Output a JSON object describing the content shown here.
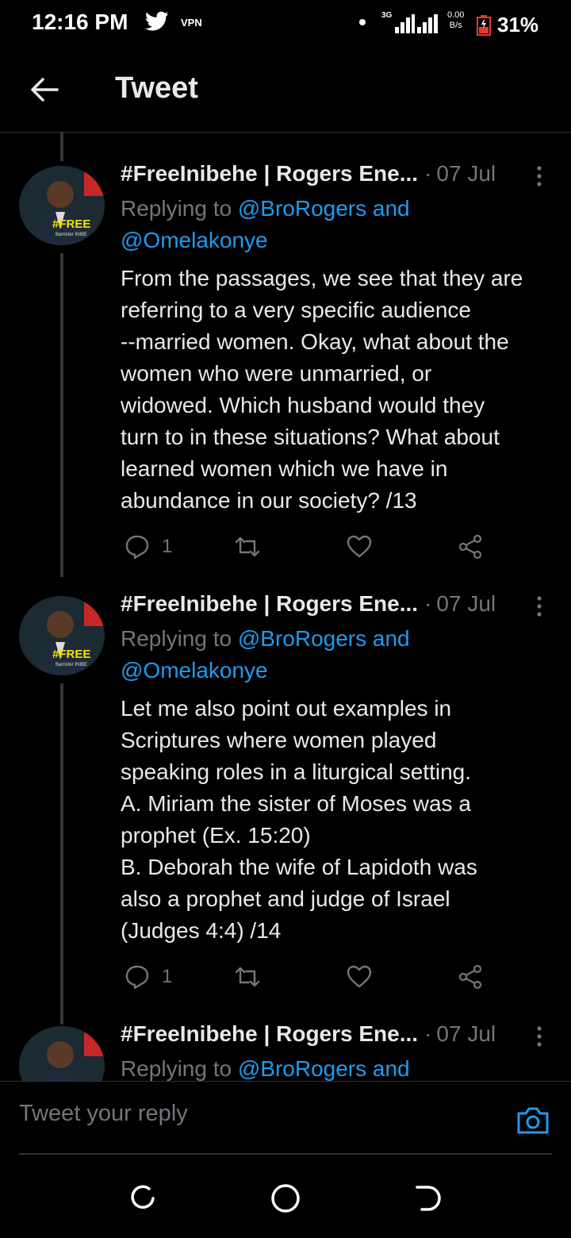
{
  "status_bar": {
    "time": "12:16 PM",
    "vpn": "VPN",
    "network_type": "3G",
    "speed_value": "0.00",
    "speed_unit": "B/s",
    "battery": "31%",
    "icons": [
      "twitter-icon",
      "signal-icon",
      "battery-icon"
    ]
  },
  "header": {
    "title": "Tweet",
    "back_icon": "arrow-left-icon"
  },
  "tweets": [
    {
      "author": "#FreeInibehe | Rogers Ene...",
      "separator": "·",
      "date": "07 Jul",
      "reply_prefix": "Replying to",
      "mention1": "@BroRogers and",
      "mention2": "@Omelakonye",
      "body": "From the passages, we see that they are\nreferring to a very specific audience\n--married women. Okay, what about the\nwomen who were unmarried, or\nwidowed. Which husband would they\nturn to in these situations? What about\nlearned women which we have in\nabundance in our society? /13",
      "reply_count": "1",
      "avatar_badge": "#FREE",
      "avatar_caption": "Barrister INIBE"
    },
    {
      "author": "#FreeInibehe | Rogers Ene...",
      "separator": "·",
      "date": "07 Jul",
      "reply_prefix": "Replying to",
      "mention1": "@BroRogers and",
      "mention2": "@Omelakonye",
      "body": "Let me also point out examples in\nScriptures where women played\nspeaking roles in a liturgical setting.\nA. Miriam the sister of Moses was a\nprophet (Ex. 15:20)\nB. Deborah the wife of Lapidoth was\nalso a prophet and judge of Israel\n(Judges 4:4) /14",
      "reply_count": "1",
      "avatar_badge": "#FREE",
      "avatar_caption": "Barrister INIBE"
    },
    {
      "author": "#FreeInibehe | Rogers Ene...",
      "separator": "·",
      "date": "07 Jul",
      "reply_prefix": "Replying to",
      "mention1": "@BroRogers and"
    }
  ],
  "reply_bar": {
    "placeholder": "Tweet your reply",
    "camera_icon": "camera-icon"
  },
  "nav_bar": {
    "icons": [
      "recent-apps-icon",
      "home-icon",
      "back-icon"
    ]
  },
  "colors": {
    "background": "#000000",
    "text": "#e7e9ea",
    "muted": "#71767b",
    "accent": "#1d9bf0",
    "badge": "#f5e400"
  }
}
